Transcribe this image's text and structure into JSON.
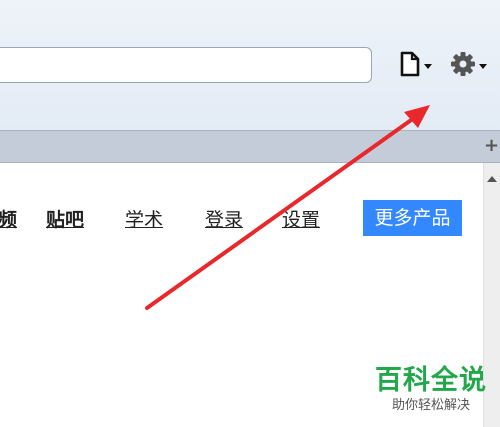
{
  "address_bar": {
    "value": "",
    "placeholder": ""
  },
  "toolbar": {
    "page_button_icon": "page-icon",
    "settings_button_icon": "gear-icon"
  },
  "tabstrip": {
    "new_tab_label": "+"
  },
  "nav": {
    "items": [
      {
        "label": "频"
      },
      {
        "label": "贴吧"
      },
      {
        "label": "学术"
      },
      {
        "label": "登录"
      },
      {
        "label": "设置"
      }
    ],
    "more_products": "更多产品"
  },
  "annotation": {
    "color": "#e8282b"
  },
  "watermark": {
    "title": "百科全说",
    "subtitle": "助你轻松解决"
  }
}
